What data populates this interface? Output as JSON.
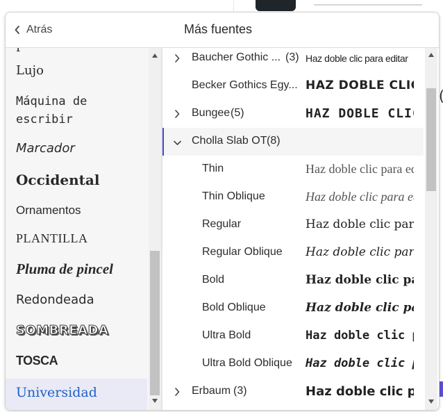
{
  "header": {
    "back_label": "Atrás",
    "title": "Más fuentes"
  },
  "categories": [
    {
      "label": "Lujo"
    },
    {
      "label": "Máquina de escribir"
    },
    {
      "label": "Marcador"
    },
    {
      "label": "Occidental"
    },
    {
      "label": "Ornamentos"
    },
    {
      "label": "PLANTILLA"
    },
    {
      "label": "Pluma de pincel"
    },
    {
      "label": "Redondeada"
    },
    {
      "label": "SOMBREADA"
    },
    {
      "label": "TOSCA"
    },
    {
      "label": "Universidad"
    }
  ],
  "selected_category": "Universidad",
  "fonts": [
    {
      "name": "Baucher Gothic ...",
      "count": "(3)",
      "preview": "Haz doble clic para editar",
      "expandable": true
    },
    {
      "name": "Becker Gothics Egy...",
      "count": "",
      "preview": "HAZ DOBLE CLIC PARA EDITAR",
      "expandable": false
    },
    {
      "name": "Bungee",
      "count": "(5)",
      "preview": "HAZ DOBLE CLIC PARA EDITAR",
      "expandable": true
    },
    {
      "name": "Cholla Slab OT",
      "count": "(8)",
      "preview": "",
      "expandable": true,
      "expanded": true
    },
    {
      "name": "Thin",
      "preview": "Haz doble clic para editar"
    },
    {
      "name": "Thin Oblique",
      "preview": "Haz doble clic para editar"
    },
    {
      "name": "Regular",
      "preview": "Haz doble clic para editar"
    },
    {
      "name": "Regular Oblique",
      "preview": "Haz doble clic para editar"
    },
    {
      "name": "Bold",
      "preview": "Haz doble clic para editar"
    },
    {
      "name": "Bold Oblique",
      "preview": "Haz doble clic para editar"
    },
    {
      "name": "Ultra Bold",
      "preview": "Haz doble clic para editar"
    },
    {
      "name": "Ultra Bold Oblique",
      "preview": "Haz doble clic para editar"
    },
    {
      "name": "Erbaum",
      "count": "(3)",
      "preview": "Haz doble clic para editar",
      "expandable": true
    }
  ],
  "colors": {
    "accent": "#4a47c9",
    "selected_text": "#1e5fc9",
    "selected_bg": "#e9eaf6"
  }
}
